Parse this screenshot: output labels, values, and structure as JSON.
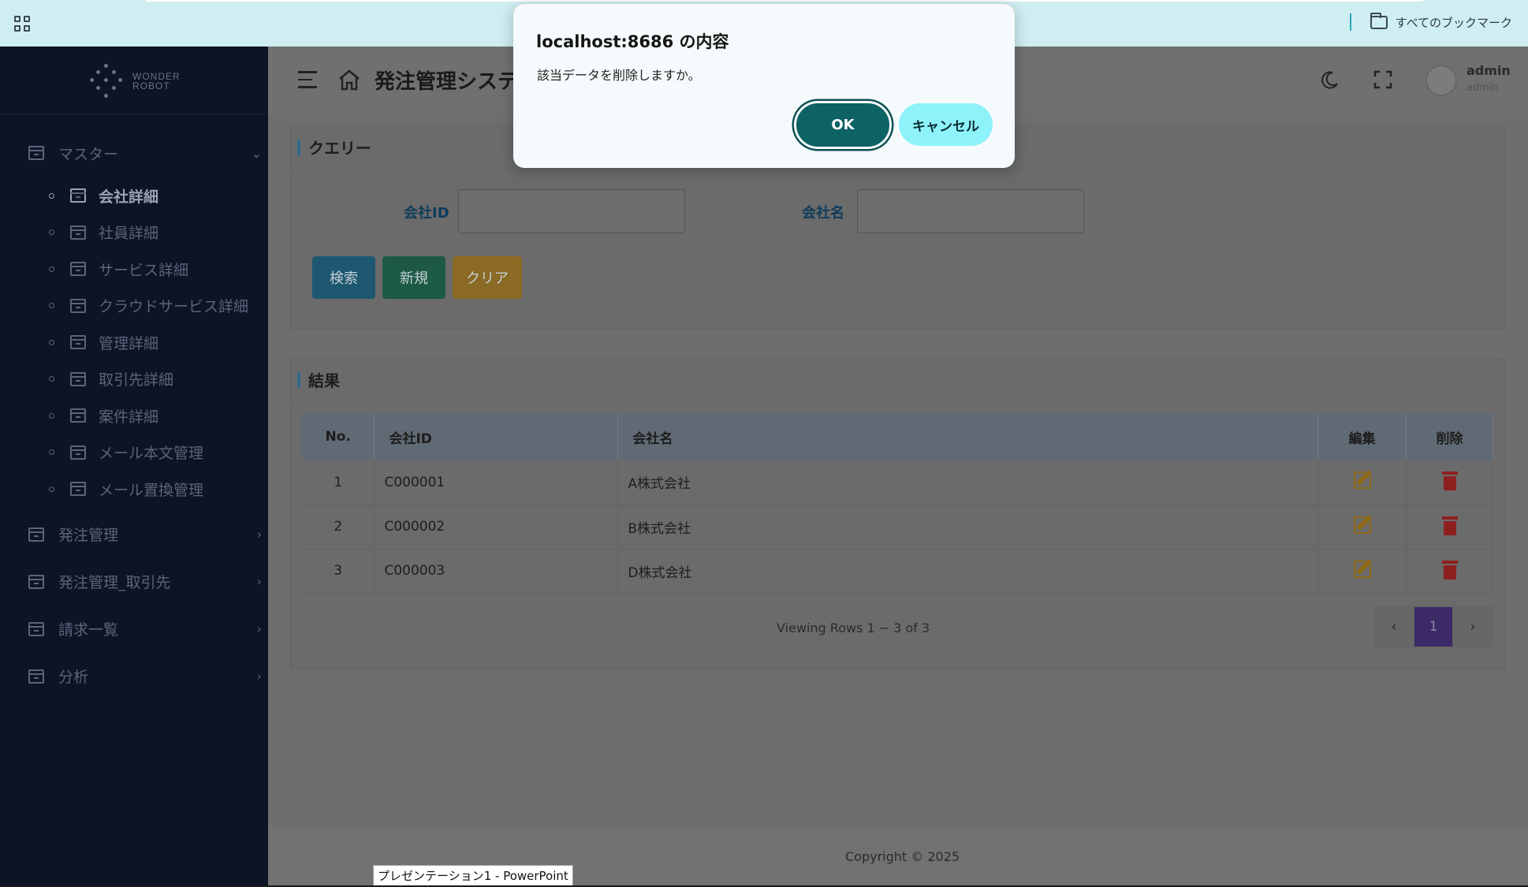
{
  "browser": {
    "bookmarks_label": "すべてのブックマーク"
  },
  "dialog": {
    "title": "localhost:8686 の内容",
    "message": "該当データを削除しますか。",
    "ok_label": "OK",
    "cancel_label": "キャンセル"
  },
  "sidebar": {
    "logo_line1": "WONDER",
    "logo_line2": "ROBOT",
    "master_label": "マスター",
    "master_items": [
      {
        "label": "会社詳細",
        "active": true
      },
      {
        "label": "社員詳細"
      },
      {
        "label": "サービス詳細"
      },
      {
        "label": "クラウドサービス詳細"
      },
      {
        "label": "管理詳細"
      },
      {
        "label": "取引先詳細"
      },
      {
        "label": "案件詳細"
      },
      {
        "label": "メール本文管理"
      },
      {
        "label": "メール置換管理"
      }
    ],
    "groups": [
      {
        "label": "発注管理"
      },
      {
        "label": "発注管理_取引先"
      },
      {
        "label": "請求一覧"
      },
      {
        "label": "分析"
      }
    ]
  },
  "header": {
    "title": "発注管理システ",
    "user_name": "admin",
    "user_role": "admin"
  },
  "query": {
    "heading": "クエリー",
    "company_id_label": "会社ID",
    "company_id_value": "",
    "company_name_label": "会社名",
    "company_name_value": "",
    "search_label": "検索",
    "new_label": "新規",
    "clear_label": "クリア"
  },
  "results": {
    "heading": "結果",
    "columns": [
      "No.",
      "会社ID",
      "会社名",
      "編集",
      "削除"
    ],
    "rows": [
      {
        "no": "1",
        "id": "C000001",
        "name": "A株式会社"
      },
      {
        "no": "2",
        "id": "C000002",
        "name": "B株式会社"
      },
      {
        "no": "3",
        "id": "C000003",
        "name": "D株式会社"
      }
    ],
    "viewing_text": "Viewing Rows 1 − 3 of 3",
    "pager_prev": "‹",
    "pager_current": "1",
    "pager_next": "›"
  },
  "footer": {
    "copyright": "Copyright © 2025"
  },
  "taskbar": {
    "tooltip": "プレゼンテーション1 - PowerPoint"
  },
  "colors": {
    "dialog_ok": "#0d6264",
    "dialog_cancel": "#8ef2fb",
    "sidebar_bg": "#0c1426",
    "bookmark_bar": "#cfeef1"
  }
}
